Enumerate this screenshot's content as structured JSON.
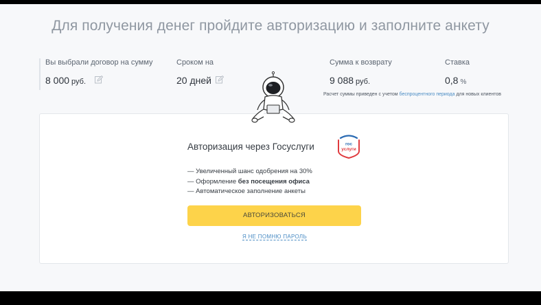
{
  "heading": "Для получения денег пройдите авторизацию и заполните анкету",
  "summary": {
    "amount": {
      "label": "Вы выбрали договор на сумму",
      "value": "8 000",
      "unit": "руб."
    },
    "term": {
      "label": "Сроком на",
      "value": "20 дней"
    },
    "return": {
      "label": "Сумма к возврату",
      "value": "9 088",
      "unit": "руб."
    },
    "rate": {
      "label": "Ставка",
      "value": "0,8",
      "unit": "%"
    }
  },
  "note": {
    "before": "Расчет суммы приведен с учетом ",
    "link": "беспроцентного периода",
    "after": " для новых клиентов"
  },
  "auth": {
    "title": "Авторизация через Госуслуги",
    "logo_top": "гос",
    "logo_bottom": "услуги",
    "features": [
      {
        "prefix": "— Увеличенный шанс одобрения на 30%",
        "bold": ""
      },
      {
        "prefix": "— Оформление ",
        "bold": "без посещения офиса"
      },
      {
        "prefix": "— Автоматическое заполнение анкеты",
        "bold": ""
      }
    ],
    "button": "АВТОРИЗОВАТЬСЯ",
    "forgot": "Я НЕ ПОМНЮ ПАРОЛЬ"
  },
  "colors": {
    "accent_button": "#fdd34a",
    "link": "#4a8cc4",
    "gos_blue": "#2b6bb3",
    "gos_red": "#e03a3e"
  }
}
